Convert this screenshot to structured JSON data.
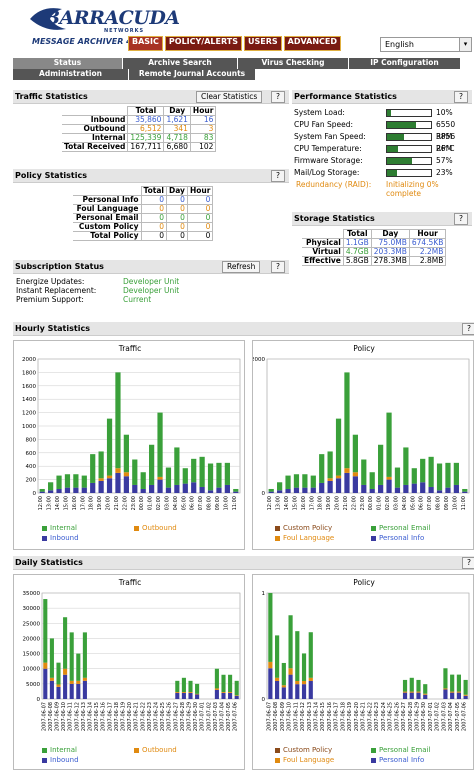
{
  "header": {
    "logo_text": "BARRACUDA",
    "logo_networks": "NETWORKS",
    "product": "MESSAGE ARCHIVER 450",
    "nav": [
      "BASIC",
      "POLICY/ALERTS",
      "USERS",
      "ADVANCED"
    ],
    "language": "English"
  },
  "subnav": [
    "Status",
    "Archive Search",
    "Virus Checking",
    "IP Configuration",
    "Administration",
    "Remote Journal Accounts"
  ],
  "traffic": {
    "title": "Traffic Statistics",
    "clear_label": "Clear Statistics",
    "help": "?",
    "cols": [
      "Total",
      "Day",
      "Hour"
    ],
    "rows": [
      {
        "label": "Inbound",
        "total": "35,860",
        "day": "1,621",
        "hour": "16"
      },
      {
        "label": "Outbound",
        "total": "6,512",
        "day": "341",
        "hour": "3"
      },
      {
        "label": "Internal",
        "total": "125,339",
        "day": "4,718",
        "hour": "83"
      },
      {
        "label": "Total Received",
        "total": "167,711",
        "day": "6,680",
        "hour": "102"
      }
    ]
  },
  "policy": {
    "title": "Policy Statistics",
    "help": "?",
    "cols": [
      "Total",
      "Day",
      "Hour"
    ],
    "rows": [
      {
        "label": "Personal Info",
        "total": "0",
        "day": "0",
        "hour": "0"
      },
      {
        "label": "Foul Language",
        "total": "0",
        "day": "0",
        "hour": "0"
      },
      {
        "label": "Personal Email",
        "total": "0",
        "day": "0",
        "hour": "0"
      },
      {
        "label": "Custom Policy",
        "total": "0",
        "day": "0",
        "hour": "0"
      },
      {
        "label": "Total Policy",
        "total": "0",
        "day": "0",
        "hour": "0"
      }
    ]
  },
  "subscription": {
    "title": "Subscription Status",
    "refresh_label": "Refresh",
    "help": "?",
    "rows": [
      {
        "label": "Energize Updates:",
        "value": "Developer Unit"
      },
      {
        "label": "Instant Replacement:",
        "value": "Developer Unit"
      },
      {
        "label": "Premium Support:",
        "value": "Current"
      }
    ]
  },
  "performance": {
    "title": "Performance Statistics",
    "help": "?",
    "rows": [
      {
        "label": "System Load:",
        "value": "10%",
        "level": 0.1
      },
      {
        "label": "CPU Fan Speed:",
        "value": "6550 RPM",
        "level": 0.65
      },
      {
        "label": "System Fan Speed:",
        "value": "3856 RPM",
        "level": 0.38
      },
      {
        "label": "CPU Temperature:",
        "value": "26°C",
        "level": 0.26
      },
      {
        "label": "Firmware Storage:",
        "value": "57%",
        "level": 0.57
      },
      {
        "label": "Mail/Log Storage:",
        "value": "23%",
        "level": 0.23
      }
    ],
    "raid_label": "Redundancy (RAID):",
    "raid_value": "Initializing 0% complete"
  },
  "storage": {
    "title": "Storage Statistics",
    "help": "?",
    "cols": [
      "Total",
      "Day",
      "Hour"
    ],
    "rows": [
      {
        "label": "Physical",
        "total": "1.1GB",
        "day": "75.0MB",
        "hour": "674.5KB"
      },
      {
        "label": "Virtual",
        "total": "4.7GB",
        "day": "203.3MB",
        "hour": "2.2MB"
      },
      {
        "label": "Effective",
        "total": "5.8GB",
        "day": "278.3MB",
        "hour": "2.8MB"
      }
    ]
  },
  "hourly": {
    "title": "Hourly Statistics",
    "help": "?"
  },
  "daily": {
    "title": "Daily Statistics",
    "help": "?"
  },
  "legends": {
    "internal": "Internal",
    "outbound": "Outbound",
    "inbound": "Inbound",
    "custom_policy": "Custom Policy",
    "personal_email": "Personal Email",
    "foul_language": "Foul Language",
    "personal_info": "Personal Info"
  },
  "colors": {
    "green": "#3aa03a",
    "orange": "#e08a10",
    "blue": "#3a3aa0",
    "brown": "#8a4a1a"
  },
  "chart_data": [
    {
      "type": "bar",
      "title": "Traffic",
      "ylim": [
        0,
        2000
      ],
      "yticks": [
        0,
        200,
        400,
        600,
        800,
        1000,
        1200,
        1400,
        1600,
        1800,
        2000
      ],
      "categories": [
        "12:00",
        "13:00",
        "14:00",
        "15:00",
        "16:00",
        "17:00",
        "18:00",
        "19:00",
        "20:00",
        "21:00",
        "22:00",
        "23:00",
        "00:00",
        "01:00",
        "02:00",
        "03:00",
        "04:00",
        "05:00",
        "06:00",
        "07:00",
        "08:00",
        "09:00",
        "10:00",
        "11:00"
      ],
      "series": [
        {
          "name": "Inbound",
          "values": [
            20,
            40,
            60,
            80,
            80,
            80,
            150,
            180,
            220,
            300,
            250,
            120,
            60,
            120,
            200,
            80,
            120,
            140,
            160,
            90,
            40,
            80,
            120,
            20
          ]
        },
        {
          "name": "Outbound",
          "values": [
            0,
            0,
            0,
            0,
            0,
            0,
            0,
            40,
            40,
            70,
            60,
            0,
            0,
            0,
            40,
            0,
            0,
            0,
            0,
            0,
            0,
            0,
            0,
            0
          ]
        },
        {
          "name": "Internal",
          "values": [
            40,
            120,
            200,
            200,
            200,
            180,
            430,
            400,
            850,
            1430,
            560,
            380,
            250,
            600,
            960,
            300,
            560,
            230,
            350,
            450,
            400,
            370,
            330,
            40
          ]
        }
      ]
    },
    {
      "type": "bar",
      "title": "Policy",
      "ylim": [
        0,
        2000
      ],
      "categories": [
        "12:00",
        "13:00",
        "14:00",
        "15:00",
        "16:00",
        "17:00",
        "18:00",
        "19:00",
        "20:00",
        "21:00",
        "22:00",
        "23:00",
        "00:00",
        "01:00",
        "02:00",
        "03:00",
        "04:00",
        "05:00",
        "06:00",
        "07:00",
        "08:00",
        "09:00",
        "10:00",
        "11:00"
      ],
      "series": [
        {
          "name": "Personal Info",
          "values": [
            20,
            40,
            60,
            80,
            80,
            80,
            150,
            180,
            220,
            300,
            250,
            120,
            60,
            120,
            200,
            80,
            120,
            140,
            160,
            90,
            40,
            80,
            120,
            20
          ]
        },
        {
          "name": "Foul Language",
          "values": [
            0,
            0,
            0,
            0,
            0,
            0,
            0,
            40,
            40,
            70,
            60,
            0,
            0,
            0,
            40,
            0,
            0,
            0,
            0,
            0,
            0,
            0,
            0,
            0
          ]
        },
        {
          "name": "Custom Policy",
          "values": [
            0,
            0,
            0,
            0,
            0,
            0,
            0,
            0,
            0,
            0,
            0,
            0,
            0,
            0,
            0,
            0,
            0,
            0,
            0,
            0,
            0,
            0,
            0,
            0
          ]
        },
        {
          "name": "Personal Email",
          "values": [
            40,
            120,
            200,
            200,
            200,
            180,
            430,
            400,
            850,
            1430,
            560,
            380,
            250,
            600,
            960,
            300,
            560,
            230,
            350,
            450,
            400,
            370,
            330,
            40
          ]
        }
      ]
    },
    {
      "type": "bar",
      "title": "Traffic",
      "ylim": [
        0,
        35000
      ],
      "yticks": [
        0,
        5000,
        10000,
        15000,
        20000,
        25000,
        30000,
        35000
      ],
      "categories": [
        "2007-06-07",
        "2007-06-08",
        "2007-06-09",
        "2007-06-10",
        "2007-06-11",
        "2007-06-12",
        "2007-06-13",
        "2007-06-14",
        "2007-06-15",
        "2007-06-16",
        "2007-06-17",
        "2007-06-18",
        "2007-06-19",
        "2007-06-20",
        "2007-06-21",
        "2007-06-22",
        "2007-06-23",
        "2007-06-24",
        "2007-06-25",
        "2007-06-26",
        "2007-06-27",
        "2007-06-28",
        "2007-06-29",
        "2007-06-30",
        "2007-07-01",
        "2007-07-02",
        "2007-07-03",
        "2007-07-04",
        "2007-07-05",
        "2007-07-06"
      ],
      "series": [
        {
          "name": "Inbound",
          "values": [
            10000,
            6000,
            4000,
            8000,
            5000,
            5000,
            6000,
            0,
            0,
            0,
            0,
            0,
            0,
            0,
            0,
            0,
            0,
            0,
            0,
            0,
            2000,
            2000,
            2000,
            1500,
            0,
            0,
            3000,
            2000,
            2000,
            1000
          ]
        },
        {
          "name": "Outbound",
          "values": [
            2000,
            1000,
            800,
            2000,
            1000,
            1000,
            1000,
            0,
            0,
            0,
            0,
            0,
            0,
            0,
            0,
            0,
            0,
            0,
            0,
            0,
            300,
            300,
            300,
            200,
            0,
            0,
            500,
            300,
            300,
            200
          ]
        },
        {
          "name": "Internal",
          "values": [
            21000,
            13000,
            7200,
            17000,
            16000,
            9000,
            15000,
            0,
            0,
            0,
            0,
            0,
            0,
            0,
            0,
            0,
            0,
            0,
            0,
            0,
            3700,
            4700,
            3700,
            3300,
            0,
            0,
            6500,
            5700,
            5700,
            4800
          ]
        }
      ]
    },
    {
      "type": "bar",
      "title": "Policy",
      "ylim": [
        0,
        1
      ],
      "categories": [
        "2007-06-07",
        "2007-06-08",
        "2007-06-09",
        "2007-06-10",
        "2007-06-11",
        "2007-06-12",
        "2007-06-13",
        "2007-06-14",
        "2007-06-15",
        "2007-06-16",
        "2007-06-17",
        "2007-06-18",
        "2007-06-19",
        "2007-06-20",
        "2007-06-21",
        "2007-06-22",
        "2007-06-23",
        "2007-06-24",
        "2007-06-25",
        "2007-06-26",
        "2007-06-27",
        "2007-06-28",
        "2007-06-29",
        "2007-06-30",
        "2007-07-01",
        "2007-07-02",
        "2007-07-03",
        "2007-07-04",
        "2007-07-05",
        "2007-07-06"
      ],
      "series": [
        {
          "name": "Personal Info",
          "values": [
            0.29,
            0.17,
            0.11,
            0.23,
            0.14,
            0.14,
            0.17,
            0,
            0,
            0,
            0,
            0,
            0,
            0,
            0,
            0,
            0,
            0,
            0,
            0,
            0.06,
            0.06,
            0.06,
            0.04,
            0,
            0,
            0.09,
            0.06,
            0.06,
            0.03
          ]
        },
        {
          "name": "Foul Language",
          "values": [
            0.06,
            0.03,
            0.02,
            0.06,
            0.03,
            0.03,
            0.03,
            0,
            0,
            0,
            0,
            0,
            0,
            0,
            0,
            0,
            0,
            0,
            0,
            0,
            0.01,
            0.01,
            0.01,
            0.01,
            0,
            0,
            0.01,
            0.01,
            0.01,
            0.01
          ]
        },
        {
          "name": "Custom Policy",
          "values": [
            0,
            0,
            0,
            0,
            0,
            0,
            0,
            0,
            0,
            0,
            0,
            0,
            0,
            0,
            0,
            0,
            0,
            0,
            0,
            0,
            0,
            0,
            0,
            0,
            0,
            0,
            0,
            0,
            0,
            0
          ]
        },
        {
          "name": "Personal Email",
          "values": [
            0.65,
            0.4,
            0.21,
            0.5,
            0.47,
            0.26,
            0.43,
            0,
            0,
            0,
            0,
            0,
            0,
            0,
            0,
            0,
            0,
            0,
            0,
            0,
            0.11,
            0.13,
            0.11,
            0.09,
            0,
            0,
            0.19,
            0.16,
            0.16,
            0.14
          ]
        }
      ]
    }
  ]
}
